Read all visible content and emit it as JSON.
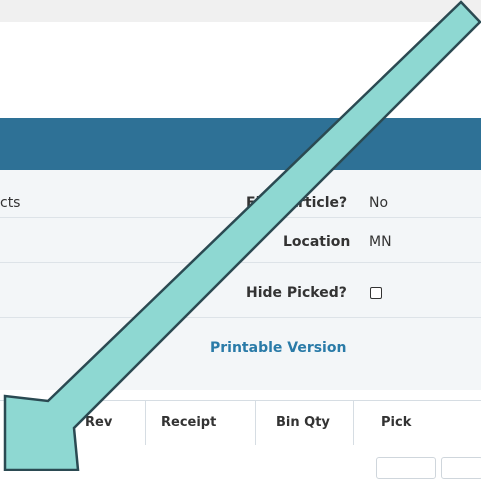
{
  "info": {
    "left_partial": "cts",
    "first_article_label": "First Article?",
    "first_article_value": "No",
    "location_label": "Location",
    "location_value": "MN",
    "hide_picked_label": "Hide Picked?",
    "printable_version": "Printable Version"
  },
  "table": {
    "headers": [
      "Rev",
      "Receipt",
      "Bin Qty",
      "Pick Qty/Seria"
    ]
  },
  "colors": {
    "header_bar": "#2e7196",
    "link": "#2a7ba8",
    "arrow_fill": "#8ed8d2"
  }
}
